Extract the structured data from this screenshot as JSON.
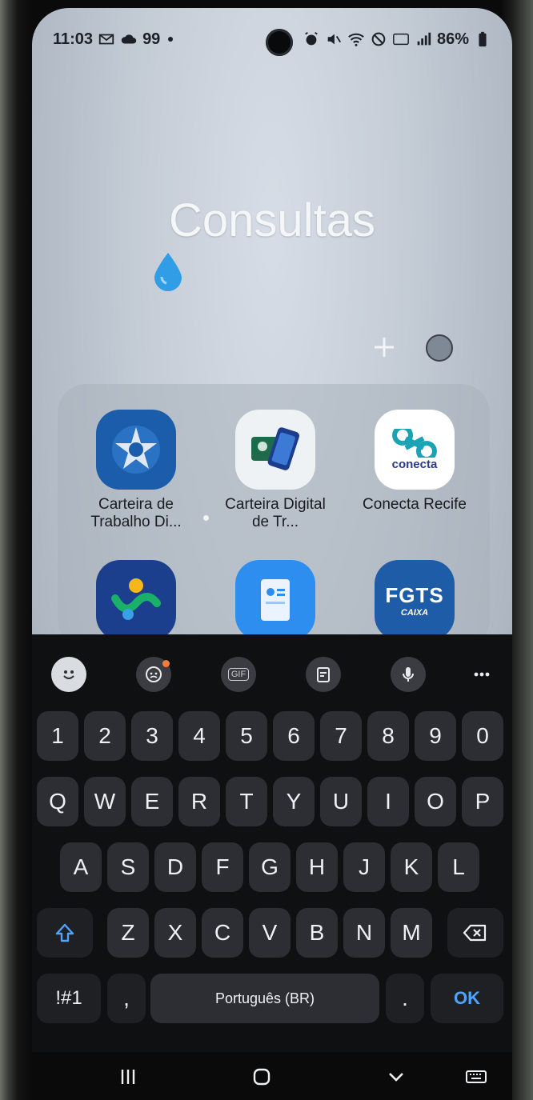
{
  "status_bar": {
    "time": "11:03",
    "left_extra": "99",
    "battery": "86%"
  },
  "folder": {
    "title": "Consultas",
    "apps": [
      {
        "name": "Carteira de Trabalho Di..."
      },
      {
        "name": "Carteira Digital de Tr..."
      },
      {
        "name": "Conecta Recife",
        "logo_text": "conecta"
      },
      {
        "name": ""
      },
      {
        "name": ""
      },
      {
        "name": "",
        "logo_text": "FGTS",
        "sub_logo": "CAIXA"
      }
    ]
  },
  "keyboard": {
    "number_row": [
      "1",
      "2",
      "3",
      "4",
      "5",
      "6",
      "7",
      "8",
      "9",
      "0"
    ],
    "row1": [
      "Q",
      "W",
      "E",
      "R",
      "T",
      "Y",
      "U",
      "I",
      "O",
      "P"
    ],
    "row2": [
      "A",
      "S",
      "D",
      "F",
      "G",
      "H",
      "J",
      "K",
      "L"
    ],
    "row3": [
      "Z",
      "X",
      "C",
      "V",
      "B",
      "N",
      "M"
    ],
    "symbols_key": "!#1",
    "comma_key": ",",
    "space_label": "Português (BR)",
    "period_key": ".",
    "ok_key": "OK",
    "toolbar": {
      "gif_label": "GIF"
    }
  },
  "colors": {
    "accent": "#4ea4ff",
    "keyboard_bg": "#0f1012",
    "key_bg": "#2c2e33"
  }
}
